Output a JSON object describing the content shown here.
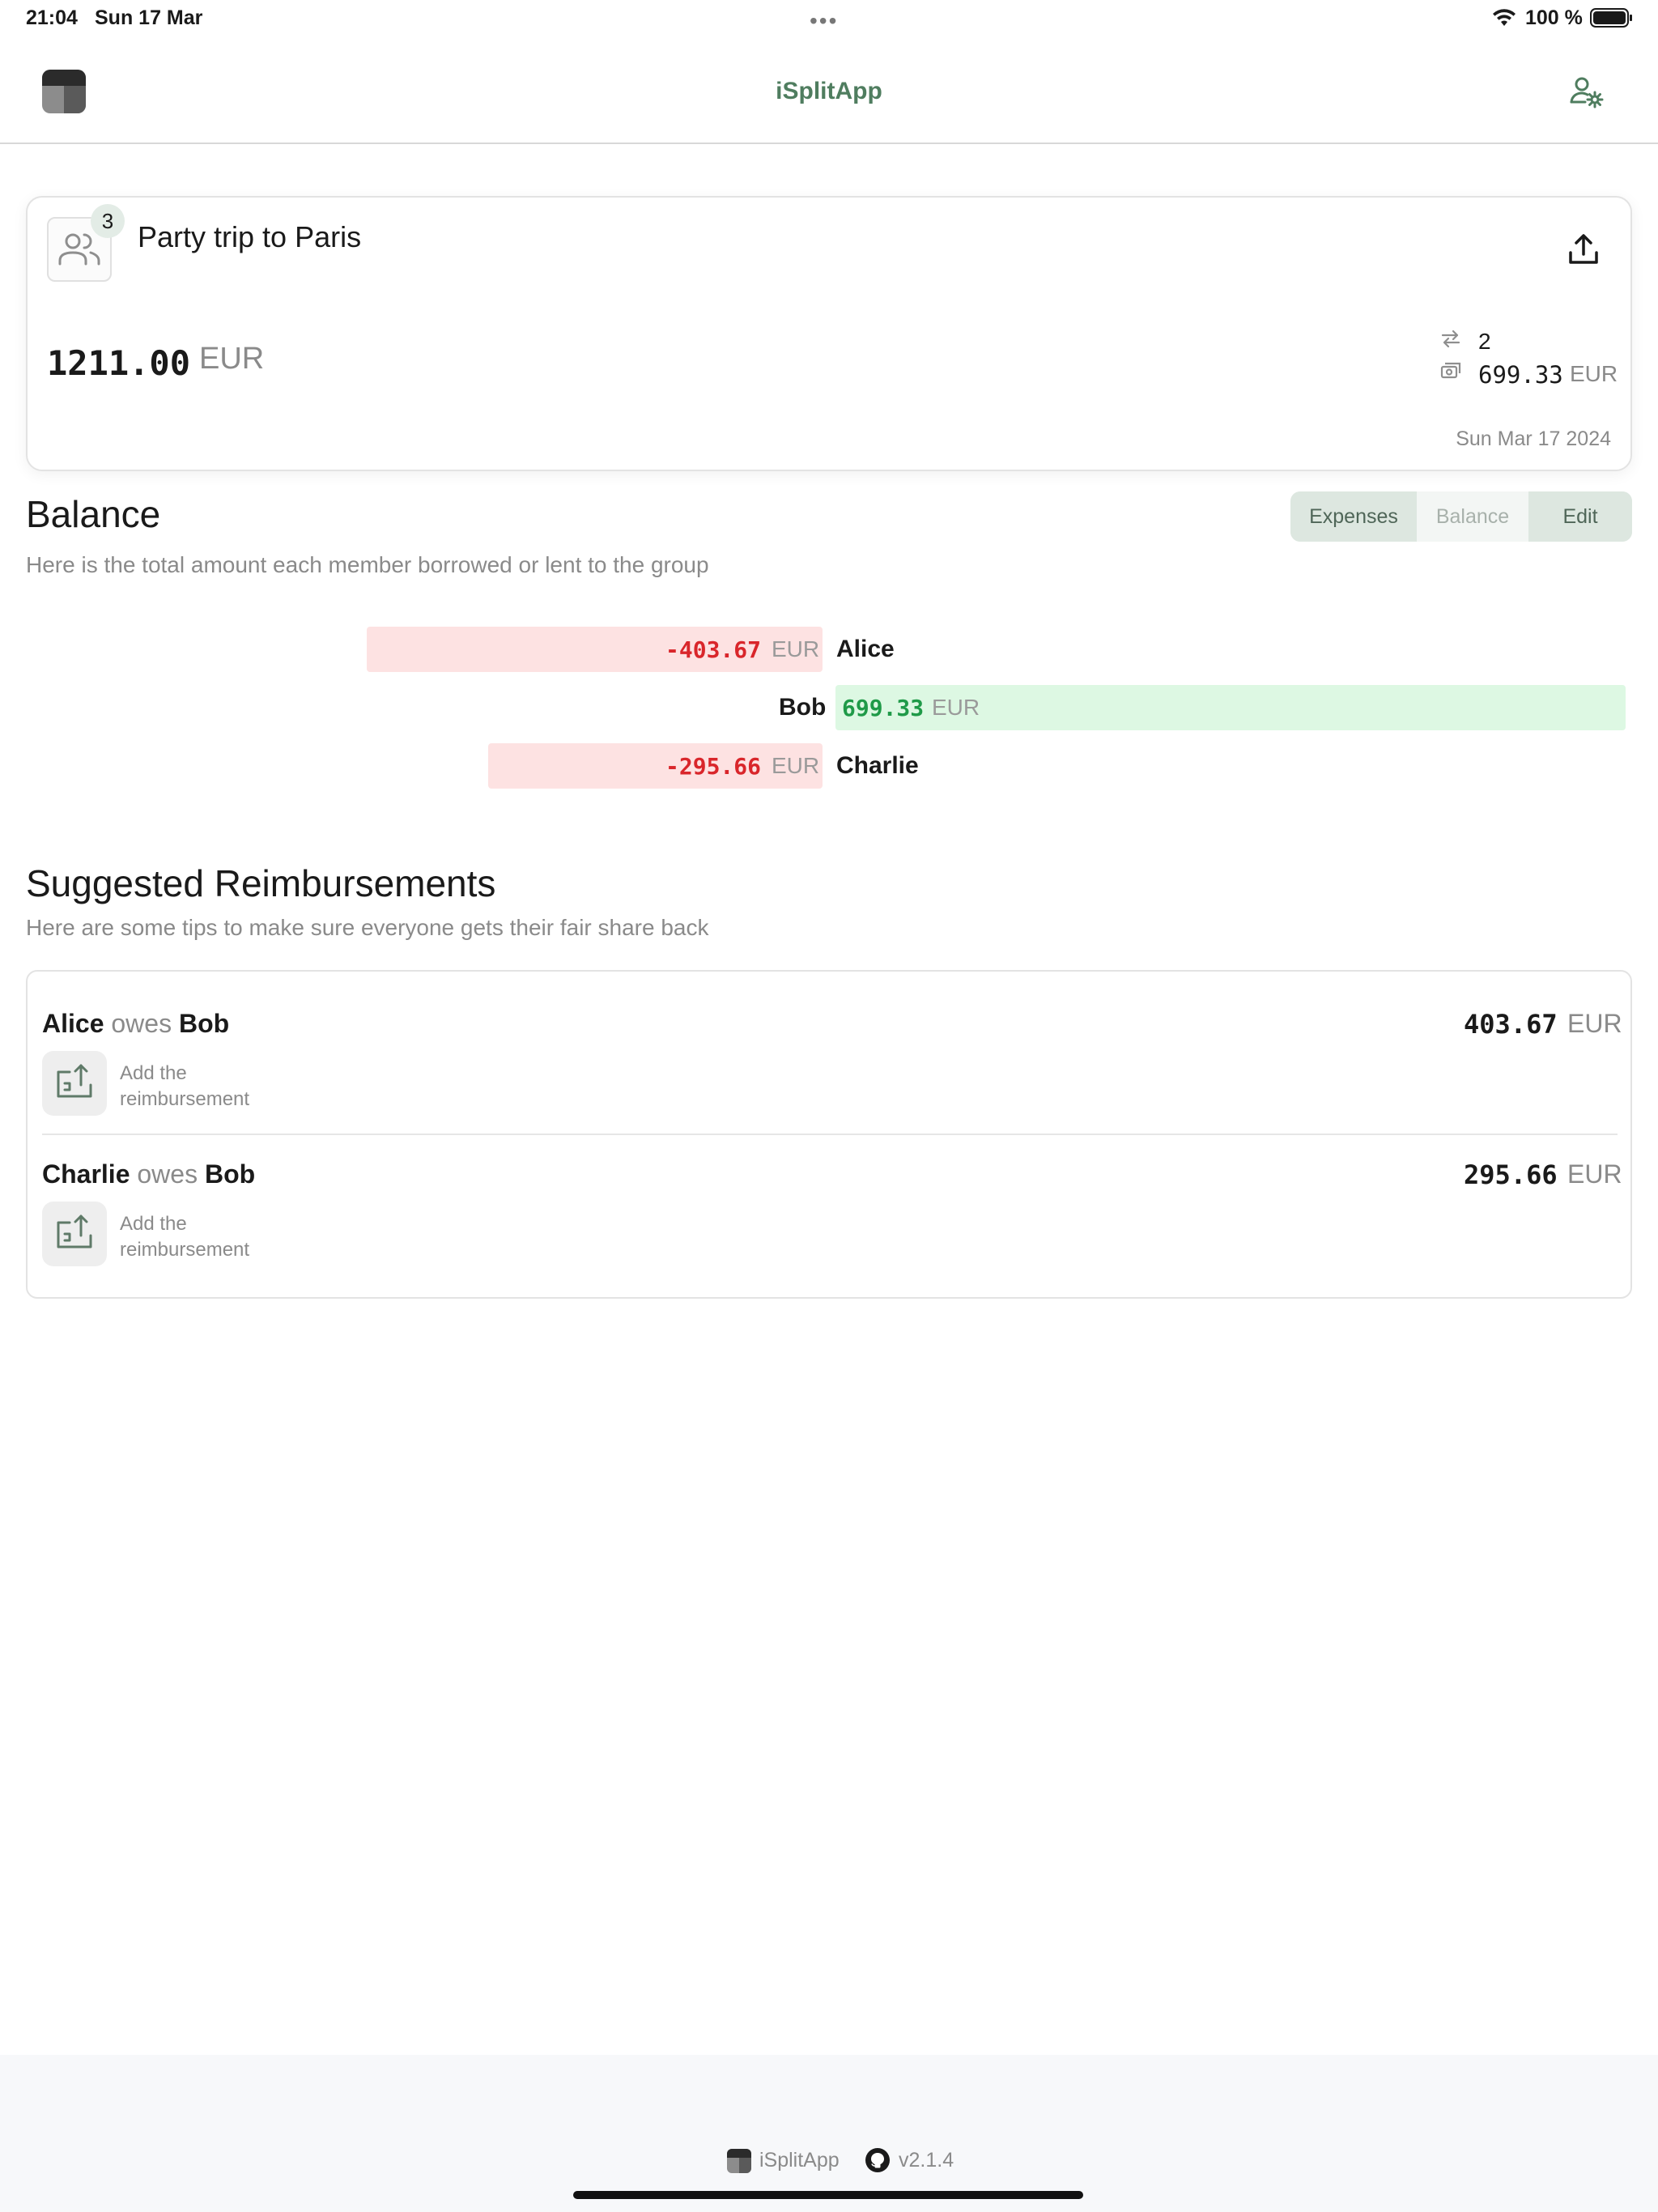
{
  "status_bar": {
    "time": "21:04",
    "date": "Sun 17 Mar",
    "battery": "100 %"
  },
  "header": {
    "title": "iSplitApp"
  },
  "group": {
    "members_count": "3",
    "name": "Party trip to Paris",
    "total": "1211.00",
    "currency": "EUR",
    "transactions": "2",
    "average": "699.33",
    "date": "Sun Mar 17 2024"
  },
  "balance_section": {
    "title": "Balance",
    "subtitle": "Here is the total amount each member borrowed or lent to the group",
    "tabs": {
      "expenses": "Expenses",
      "balance": "Balance",
      "edit": "Edit"
    },
    "members": [
      {
        "name": "Alice",
        "amount": "-403.67",
        "currency": "EUR",
        "value": -403.67
      },
      {
        "name": "Bob",
        "amount": "699.33",
        "currency": "EUR",
        "value": 699.33
      },
      {
        "name": "Charlie",
        "amount": "-295.66",
        "currency": "EUR",
        "value": -295.66
      }
    ]
  },
  "reimbursements_section": {
    "title": "Suggested Reimbursements",
    "subtitle": "Here are some tips to make sure everyone gets their fair share back",
    "owes_word": "owes",
    "add_line1": "Add the",
    "add_line2": "reimbursement",
    "items": [
      {
        "from": "Alice",
        "to": "Bob",
        "amount": "403.67",
        "currency": "EUR"
      },
      {
        "from": "Charlie",
        "to": "Bob",
        "amount": "295.66",
        "currency": "EUR"
      }
    ]
  },
  "footer": {
    "app_name": "iSplitApp",
    "version": "v2.1.4"
  },
  "colors": {
    "accent": "#4f7d5f",
    "negative": "#d9262b",
    "positive": "#1f9a48",
    "negative_bg": "#fde2e2",
    "positive_bg": "#ddf8e3"
  },
  "icons": [
    "app-logo-icon",
    "user-gear-icon",
    "group-icon",
    "share-upload-icon",
    "transfer-arrows-icon",
    "money-icon",
    "reimbursement-upload-icon",
    "github-icon",
    "wifi-icon",
    "battery-icon"
  ]
}
